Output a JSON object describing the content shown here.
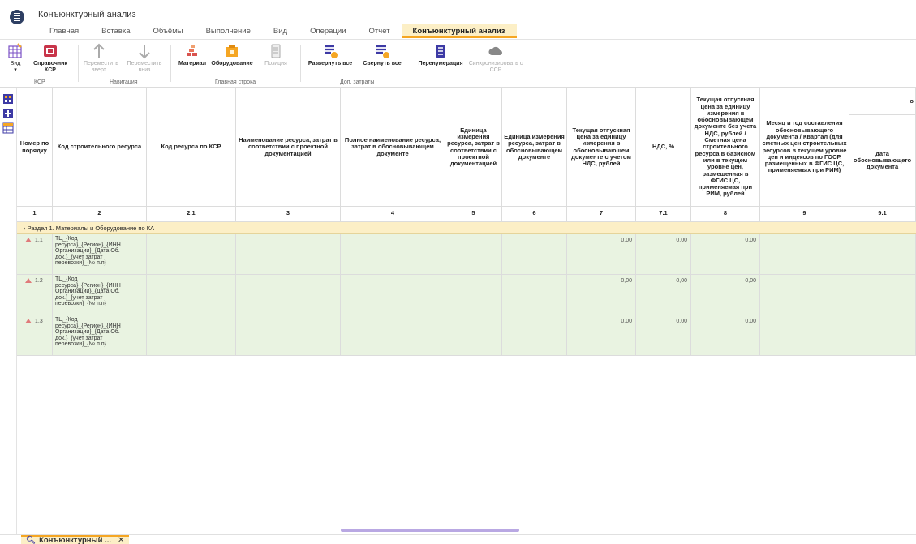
{
  "app": {
    "title": "Конъюнктурный анализ"
  },
  "tabs": [
    {
      "label": "Главная"
    },
    {
      "label": "Вставка"
    },
    {
      "label": "Объёмы"
    },
    {
      "label": "Выполнение"
    },
    {
      "label": "Вид"
    },
    {
      "label": "Операции"
    },
    {
      "label": "Отчет"
    },
    {
      "label": "Конъюнктурный анализ",
      "active": true
    }
  ],
  "ribbon": {
    "vid": "Вид",
    "spravochnik": "Справочник КСР",
    "group_ksr": "КСР",
    "move_up": "Переместить вверх",
    "move_down": "Переместить вниз",
    "group_nav": "Навигация",
    "material": "Материал",
    "equipment": "Оборудование",
    "position": "Позиция",
    "group_main": "Главная строка",
    "expand_all": "Развернуть все",
    "collapse_all": "Свернуть все",
    "group_extra": "Доп. затраты",
    "renumber": "Перенумерация",
    "sync": "Синхронизировать с ССР",
    "accent": "#f5a623"
  },
  "columns": [
    {
      "header": "Номер по порядку",
      "num": "1"
    },
    {
      "header": "Код строительного ресурса",
      "num": "2"
    },
    {
      "header": "Код ресурса по КСР",
      "num": "2.1"
    },
    {
      "header": "Наименование ресурса, затрат в соответствии с проектной документацией",
      "num": "3"
    },
    {
      "header": "Полное наименование ресурса, затрат в обосновывающем документе",
      "num": "4"
    },
    {
      "header": "Единица измерения ресурса, затрат в соответствии с проектной документацией",
      "num": "5"
    },
    {
      "header": "Единица измерения ресурса, затрат в обосновывающем документе",
      "num": "6"
    },
    {
      "header": "Текущая отпускная цена за единицу измерения в обосновывающем документе с учетом НДС, рублей",
      "num": "7"
    },
    {
      "header": "НДС, %",
      "num": "7.1"
    },
    {
      "header": "Текущая отпускная цена за единицу измерения в обосновывающем документе без учета НДС, рублей / Сметная цена строительного ресурса в базисном или в текущем уровне цен, размещенная в ФГИС ЦС, применяемая при РИМ, рублей",
      "num": "8"
    },
    {
      "header": "Месяц и год составления обосновывающего документа / Квартал (для сметных цен строительных ресурсов в текущем уровне цен и индексов по ГОСР, размещенных в ФГИС ЦС, применяемых при РИМ)",
      "num": "9"
    },
    {
      "header": "дата обосновывающего документа",
      "num": "9.1"
    }
  ],
  "top_right_char": "о",
  "section": {
    "label": "Раздел 1. Материалы и Оборудование по КА"
  },
  "rows": [
    {
      "id": "1.1",
      "code": "ТЦ_{Код ресурса}_{Регион}_{ИНН Организации}_{Дата Об. док.}_{учет затрат перевозки}_{№ п.п}",
      "price_nds": "0,00",
      "nds": "0,00",
      "price": "0,00"
    },
    {
      "id": "1.2",
      "code": "ТЦ_{Код ресурса}_{Регион}_{ИНН Организации}_{Дата Об. док.}_{учет затрат перевозки}_{№ п.п}",
      "price_nds": "0,00",
      "nds": "0,00",
      "price": "0,00"
    },
    {
      "id": "1.3",
      "code": "ТЦ_{Код ресурса}_{Регион}_{ИНН Организации}_{Дата Об. док.}_{учет затрат перевозки}_{№ п.п}",
      "price_nds": "0,00",
      "nds": "0,00",
      "price": "0,00"
    }
  ],
  "bottom_tab": {
    "label": "Конъюнктурный ...",
    "close": "✕"
  }
}
